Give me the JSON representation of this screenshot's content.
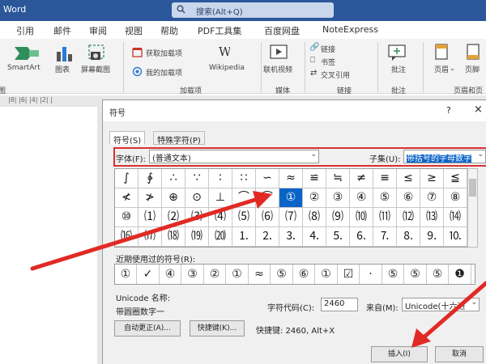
{
  "app": {
    "title": "Word"
  },
  "search": {
    "placeholder": "搜索(Alt+Q)"
  },
  "ribbon_tabs": [
    "引用",
    "邮件",
    "审阅",
    "视图",
    "帮助",
    "PDF工具集",
    "百度网盘",
    "NoteExpress"
  ],
  "ribbon": {
    "smartart": "SmartArt",
    "chart": "图表",
    "screenshot": "屏幕截图",
    "get_addins": "获取加载项",
    "my_addins": "我的加载项",
    "wikipedia": "Wikipedia",
    "online_video": "联机视频",
    "link": "链接",
    "bookmark": "书签",
    "cross_ref": "交叉引用",
    "comment": "批注",
    "header": "页眉",
    "footer": "页脚",
    "groups": {
      "illustrations": "图",
      "addins": "加载项",
      "media": "媒体",
      "links": "链接",
      "comments": "批注",
      "header_footer": "页眉和页"
    }
  },
  "ruler": {
    "marks": "|8| |6| |4| |2| |"
  },
  "dialog": {
    "title": "符号",
    "help": "?",
    "close": "×",
    "tabs": [
      "符号(S)",
      "特殊字符(P)"
    ],
    "font_label": "字体(F):",
    "font_value": "(普通文本)",
    "subset_label": "子集(U):",
    "subset_value": "带括号的字母数字",
    "symbols": [
      [
        "∫",
        "∲",
        "∴",
        "∵",
        "∶",
        "∷",
        "∽",
        "≈",
        "≌",
        "≒",
        "≠",
        "≡",
        "≤",
        "≥",
        "≦"
      ],
      [
        "≮",
        "≯",
        "⊕",
        "⊙",
        "⊥",
        "⌒",
        "⌒",
        "①",
        "②",
        "③",
        "④",
        "⑤",
        "⑥",
        "⑦",
        "⑧"
      ],
      [
        "⑩",
        "⑴",
        "⑵",
        "⑶",
        "⑷",
        "⑸",
        "⑹",
        "⑺",
        "⑻",
        "⑼",
        "⑽",
        "⑾",
        "⑿",
        "⒀",
        "⒁"
      ],
      [
        "⒃",
        "⒄",
        "⒅",
        "⒆",
        "⒇",
        "⒈",
        "⒉",
        "⒊",
        "⒋",
        "⒌",
        "⒍",
        "⒎",
        "⒏",
        "⒐",
        "⒑"
      ]
    ],
    "selected_symbol": "①",
    "recent_label": "近期使用过的符号(R):",
    "recent": [
      "①",
      "✓",
      "④",
      "③",
      "②",
      "①",
      "≈",
      "⑤",
      "⑥",
      "①",
      "☑",
      "·",
      "⑤",
      "⑤",
      "⑤",
      "❶"
    ],
    "unicode_name_label": "Unicode 名称:",
    "unicode_name": "带圆圈数字一",
    "char_code_label": "字符代码(C):",
    "char_code": "2460",
    "from_label": "来自(M):",
    "from_value": "Unicode(十六进",
    "autocorrect": "自动更正(A)...",
    "shortcut_key": "快捷键(K)...",
    "shortcut_text": "快捷键: 2460, Alt+X",
    "insert": "插入(I)",
    "cancel": "取消"
  },
  "colors": {
    "titlebar": "#2b579a",
    "highlight": "#d93030",
    "selection": "#0a64c8"
  }
}
